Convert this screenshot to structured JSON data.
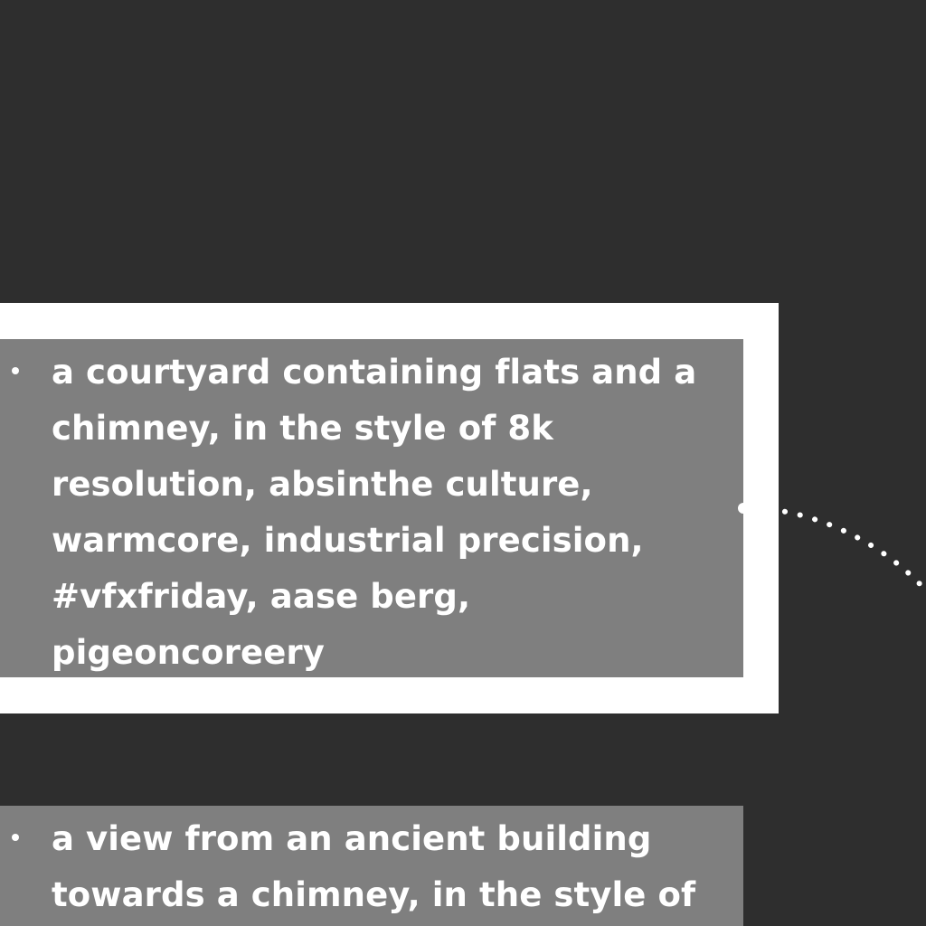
{
  "prompt_list": {
    "items": [
      {
        "text": "a courtyard containing flats and a chimney, in the style of 8k resolution, absinthe culture, warmcore, industrial precision, #vfxfriday, aase berg, pigeoncoreery",
        "selected": true
      },
      {
        "text": "a view from an ancient building towards a chimney, in the style of",
        "selected": false
      }
    ]
  },
  "colors": {
    "background": "#2e2e2e",
    "card": "#7f7f7f",
    "highlight": "#ffffff",
    "text": "#ffffff"
  }
}
